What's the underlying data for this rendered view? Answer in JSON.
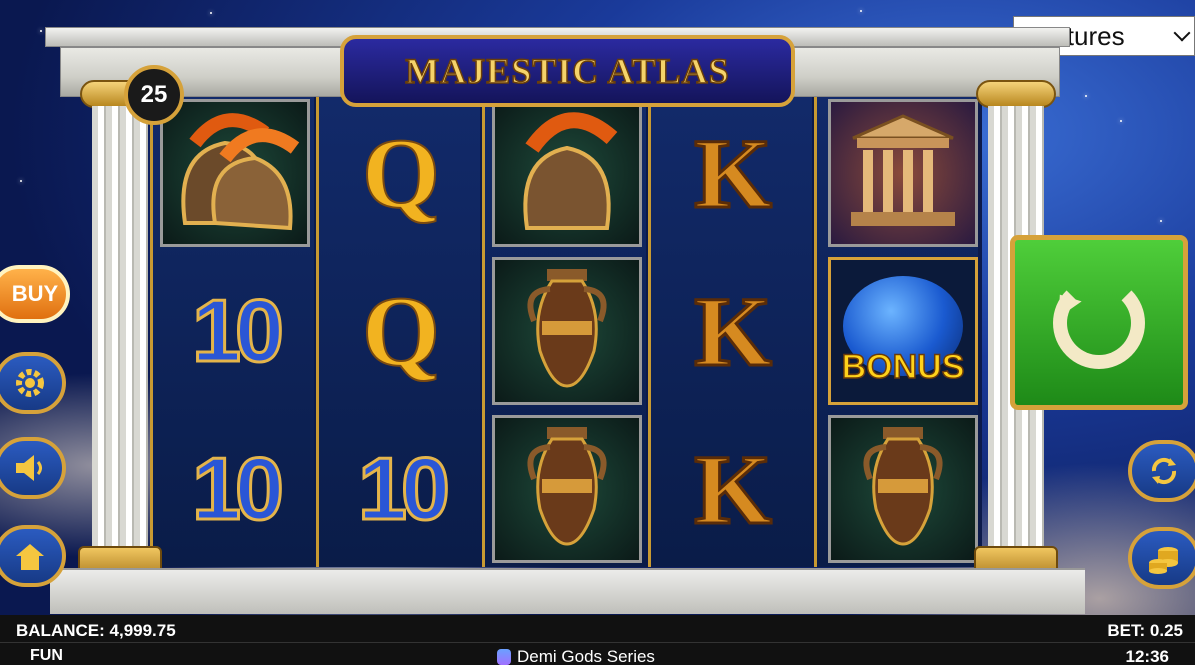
{
  "game": {
    "title": "MAJESTIC ATLAS",
    "lines": "25"
  },
  "features_select": {
    "selected": "Features"
  },
  "buttons": {
    "buy": "BUY"
  },
  "reels": [
    [
      "helmet",
      "10",
      "10"
    ],
    [
      "Q",
      "Q",
      "10"
    ],
    [
      "helmet",
      "vase",
      "vase"
    ],
    [
      "K",
      "K",
      "K"
    ],
    [
      "temple",
      "bonus",
      "vase"
    ]
  ],
  "symbols": {
    "bonus_label": "BONUS"
  },
  "status": {
    "balance_label": "BALANCE:",
    "balance_value": "4,999.75",
    "bet_label": "BET:",
    "bet_value": "0.25",
    "mode": "FUN",
    "series": "Demi Gods Series",
    "clock": "12:36"
  },
  "colors": {
    "spin_green": "#2fa822",
    "gold": "#d6a23a",
    "buy_orange": "#f08a20"
  },
  "icons": {
    "settings": "gear-icon",
    "sound": "speaker-icon",
    "home": "home-icon",
    "autoplay": "autoplay-icon",
    "bet": "coins-icon",
    "spin": "spin-icon"
  }
}
